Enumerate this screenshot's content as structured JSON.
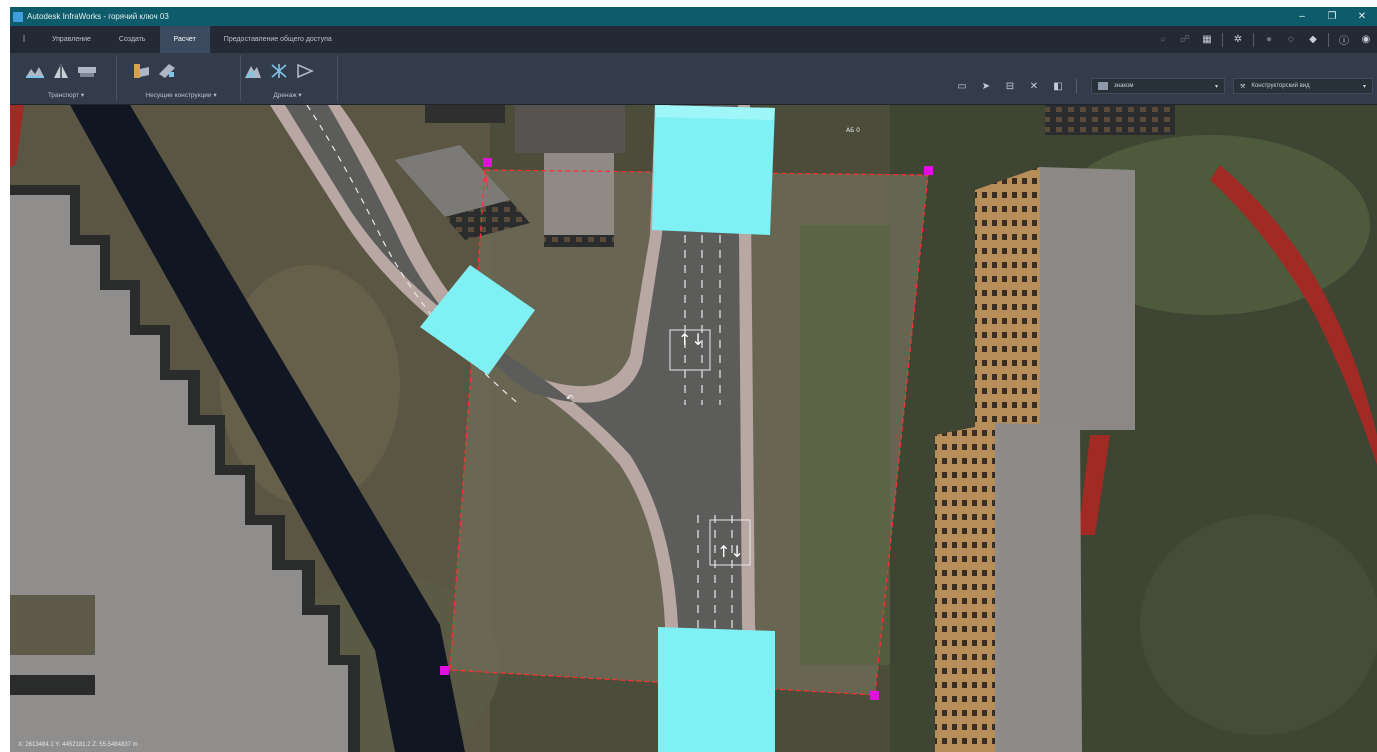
{
  "window": {
    "title": "Autodesk InfraWorks - горячий ключ 03",
    "min_glyph": "–",
    "max_glyph": "❐",
    "close_glyph": "✕"
  },
  "tabs": [
    {
      "label": "Управление",
      "active": false
    },
    {
      "label": "Создать",
      "active": false
    },
    {
      "label": "Расчет",
      "active": true
    },
    {
      "label": "Предоставление общего доступа",
      "active": false
    }
  ],
  "top_icons": [
    "search-icon",
    "user-icon",
    "calculator-icon",
    "gear-icon",
    "globe-icon",
    "sync-icon",
    "cube-icon",
    "help-icon",
    "account-icon"
  ],
  "ribbon": {
    "groups": [
      {
        "label": "Транспорт ▾",
        "icons": [
          "terrain-icon",
          "road-profile-icon",
          "road-section-icon"
        ]
      },
      {
        "label": "Несущие конструкции ▾",
        "icons": [
          "bridge-icon",
          "girder-icon"
        ]
      },
      {
        "label": "Дренаж ▾",
        "icons": [
          "watershed-icon",
          "drainage-network-icon",
          "culvert-icon"
        ]
      }
    ],
    "style_dropdown": "знаком",
    "view_dropdown": "Конструкторский вид"
  },
  "map": {
    "road_label": "АБ 0",
    "coords": "X: 2613484.1 Y: 4452181.2 Z: 55.5484837 m",
    "colors": {
      "selection": "#ff3030",
      "handle": "#e010e0",
      "pad": "#7ff0f4",
      "road": "#5c5d5b",
      "sidewalk": "#b8a7a2"
    }
  }
}
